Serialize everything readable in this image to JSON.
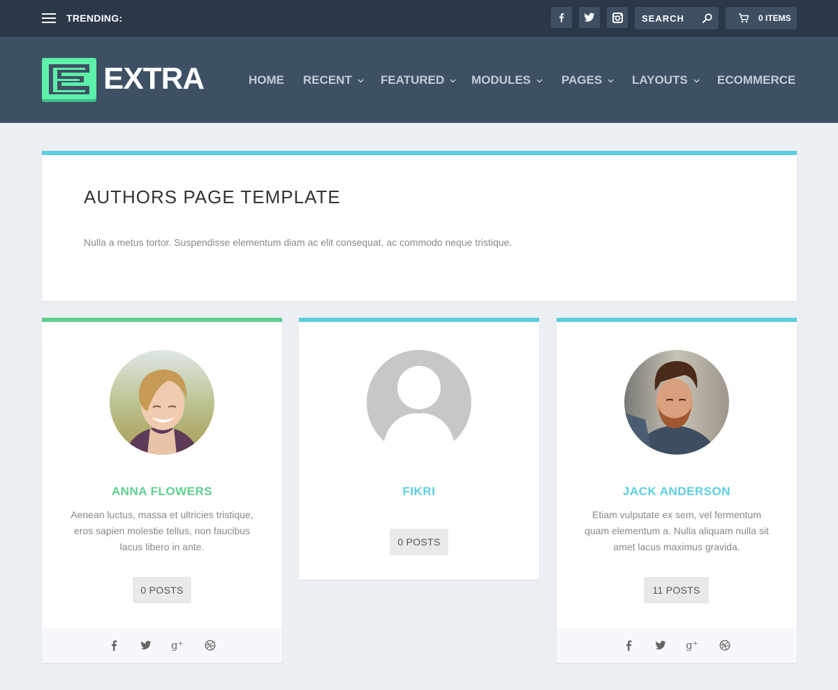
{
  "topbar": {
    "trending_label": "TRENDING:",
    "social": [
      "facebook-icon",
      "twitter-icon",
      "instagram-icon"
    ],
    "search_label": "SEARCH",
    "cart_label": "0 ITEMS"
  },
  "header": {
    "logo_text": "EXTRA",
    "nav": [
      {
        "label": "HOME",
        "dropdown": false
      },
      {
        "label": "RECENT",
        "dropdown": true
      },
      {
        "label": "FEATURED",
        "dropdown": true
      },
      {
        "label": "MODULES",
        "dropdown": true
      },
      {
        "label": "PAGES",
        "dropdown": true
      },
      {
        "label": "LAYOUTS",
        "dropdown": true
      },
      {
        "label": "ECOMMERCE",
        "dropdown": false
      }
    ]
  },
  "intro": {
    "title": "AUTHORS PAGE TEMPLATE",
    "description": "Nulla a metus tortor. Suspendisse elementum diam ac elit consequat, ac commodo neque tristique."
  },
  "authors": [
    {
      "name": "ANNA FLOWERS",
      "bio": "Aenean luctus, massa et ultricies tristique, eros sapien molestie tellus, non faucibus lacus libero in ante.",
      "posts": "0 POSTS",
      "accent": "#5fd08f"
    },
    {
      "name": "FIKRI",
      "bio": "",
      "posts": "0 POSTS",
      "accent": "#5bcfe0"
    },
    {
      "name": "JACK ANDERSON",
      "bio": "Etiam vulputate ex sem, vel fermentum quam elementum a. Nulla aliquam nulla sit amet lacus maximus gravida.",
      "posts": "11 POSTS",
      "accent": "#5bcfe0"
    }
  ],
  "colors": {
    "topbar_bg": "#2b3848",
    "header_bg": "#3e5064",
    "logo_green": "#5cf0a8",
    "accent_blue": "#5bcfe0",
    "accent_green": "#5fd08f"
  }
}
